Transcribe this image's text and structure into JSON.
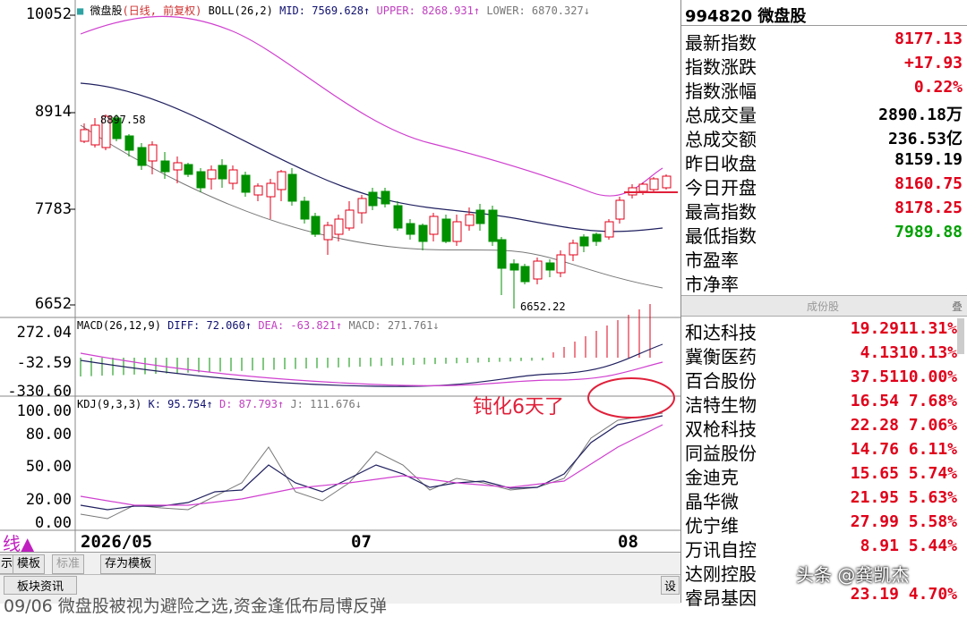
{
  "main": {
    "price_header": {
      "name": "微盘股",
      "mode": "(日线, 前复权)",
      "boll_label": "BOLL(26,2)",
      "mid": "MID: 7569.628↑",
      "upper": "UPPER: 8268.931↑",
      "lower": "LOWER: 6870.327↓"
    },
    "price_axis": [
      "10052",
      "8914",
      "7783",
      "6652"
    ],
    "high_label": "8897.58",
    "low_label": "6652.22",
    "macd_header": {
      "label": "MACD(26,12,9)",
      "diff": "DIFF: 72.060↑",
      "dea": "DEA: -63.821↑",
      "macd": "MACD: 271.761↓"
    },
    "macd_axis": [
      "272.04",
      "-32.59",
      "-330.60"
    ],
    "kdj_header": {
      "label": "KDJ(9,3,3)",
      "k": "K: 95.754↑",
      "d": "D: 87.793↑",
      "j": "J: 111.676↓"
    },
    "kdj_axis": [
      "100.00",
      "80.00",
      "50.00",
      "20.00",
      "0.00"
    ],
    "annotation": "钝化6天了",
    "date_axis": [
      "2026/05",
      "07",
      "08"
    ],
    "left_marker": "线▲"
  },
  "toolbar": {
    "items": [
      "示",
      "模板",
      "标准",
      "存为模板"
    ],
    "row2": [
      "板块资讯"
    ],
    "set_label": "设",
    "news": "09/06 微盘股被视为避险之选,资金逢低布局博反弹"
  },
  "sidebar": {
    "title": "994820 微盘股",
    "quotes": [
      {
        "label": "最新指数",
        "value": "8177.13",
        "color": "#e0001a"
      },
      {
        "label": "指数涨跌",
        "value": "+17.93",
        "color": "#e0001a"
      },
      {
        "label": "指数涨幅",
        "value": "0.22%",
        "color": "#e0001a"
      },
      {
        "label": "总成交量",
        "value": "2890.18万",
        "color": "#000000"
      },
      {
        "label": "总成交额",
        "value": "236.53亿",
        "color": "#000000"
      },
      {
        "label": "昨日收盘",
        "value": "8159.19",
        "color": "#000000"
      },
      {
        "label": "今日开盘",
        "value": "8160.75",
        "color": "#e0001a"
      },
      {
        "label": "最高指数",
        "value": "8178.25",
        "color": "#e0001a"
      },
      {
        "label": "最低指数",
        "value": "7989.88",
        "color": "#00a000"
      },
      {
        "label": "市盈率",
        "value": "",
        "color": "#000000"
      },
      {
        "label": "市净率",
        "value": "",
        "color": "#000000"
      }
    ],
    "constituents_header": "成份股",
    "constituents_tab": "叠",
    "stocks": [
      {
        "name": "和达科技",
        "value": "19.2911.31%"
      },
      {
        "name": "冀衡医药",
        "value": "4.1310.13%"
      },
      {
        "name": "百合股份",
        "value": "37.5110.00%"
      },
      {
        "name": "洁特生物",
        "value": "16.54 7.68%"
      },
      {
        "name": "双枪科技",
        "value": "22.28 7.06%"
      },
      {
        "name": "同益股份",
        "value": "14.76 6.11%"
      },
      {
        "name": "金迪克",
        "value": "15.65 5.74%"
      },
      {
        "name": "晶华微",
        "value": "21.95 5.63%"
      },
      {
        "name": "优宁维",
        "value": "27.99 5.58%"
      },
      {
        "name": "万讯自控",
        "value": "8.91 5.44%"
      },
      {
        "name": "达刚控股",
        "value": ""
      },
      {
        "name": "睿昂基因",
        "value": "23.19 4.70%"
      }
    ],
    "watermark": "头条 @龚凯杰"
  }
}
